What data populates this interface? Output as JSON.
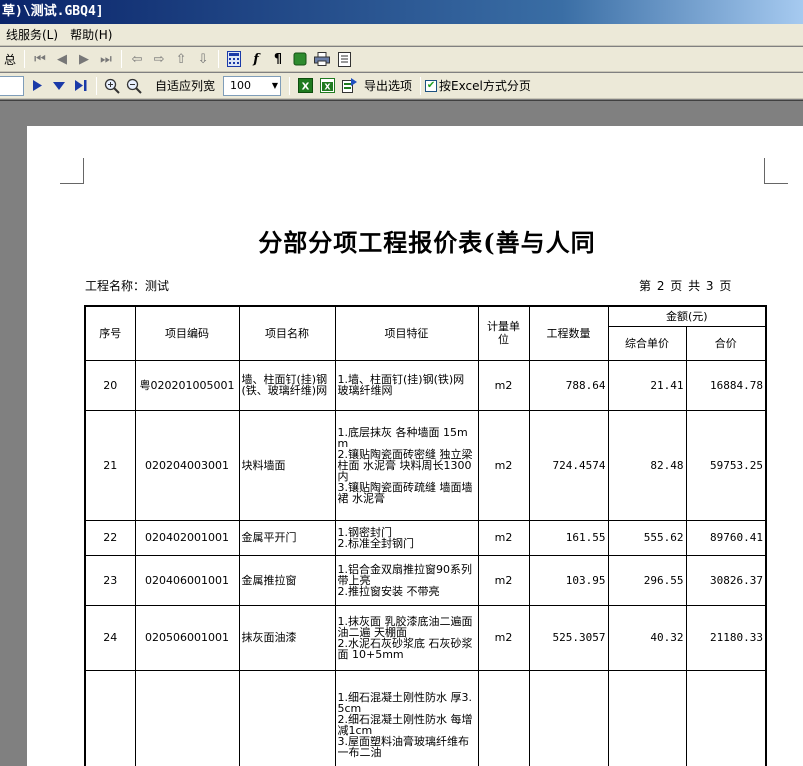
{
  "window": {
    "title": "草)\\测试.GBQ4]"
  },
  "menu": {
    "items": [
      "线服务(L)",
      "帮助(H)"
    ]
  },
  "toolbar1": {
    "left_label": "总"
  },
  "toolbar2": {
    "fit_width_label": "自适应列宽",
    "zoom_value": "100",
    "export_label": "导出选项",
    "excel_paging_label": "按Excel方式分页"
  },
  "report": {
    "title": "分部分项工程报价表(善与人同",
    "project_label": "工程名称：测试",
    "page_info": "第 2 页 共 3 页",
    "headers": {
      "seq": "序号",
      "code": "项目编码",
      "name": "项目名称",
      "feature": "项目特征",
      "unit": "计量单位",
      "qty": "工程数量",
      "amount": "金额(元)",
      "unit_price": "综合单价",
      "total": "合价"
    },
    "rows": [
      {
        "seq": "20",
        "code": "粤020201005001",
        "name": "墙、柱面钉(挂)钢(铁、玻璃纤维)网",
        "feature": "1.墙、柱面钉(挂)钢(铁)网 玻璃纤维网",
        "unit": "m2",
        "qty": "788.64",
        "unit_price": "21.41",
        "total": "16884.78"
      },
      {
        "seq": "21",
        "code": "020204003001",
        "name": "块料墙面",
        "feature": "1.底层抹灰 各种墙面 15mm\n2.镶贴陶瓷面砖密缝 独立梁柱面 水泥膏 块料周长1300内\n3.镶贴陶瓷面砖疏缝 墙面墙裙 水泥膏",
        "unit": "m2",
        "qty": "724.4574",
        "unit_price": "82.48",
        "total": "59753.25"
      },
      {
        "seq": "22",
        "code": "020402001001",
        "name": "金属平开门",
        "feature": "1.钢密封门\n2.标准全封钢门",
        "unit": "m2",
        "qty": "161.55",
        "unit_price": "555.62",
        "total": "89760.41"
      },
      {
        "seq": "23",
        "code": "020406001001",
        "name": "金属推拉窗",
        "feature": "1.铝合金双扇推拉窗90系列 带上亮\n2.推拉窗安装  不带亮",
        "unit": "m2",
        "qty": "103.95",
        "unit_price": "296.55",
        "total": "30826.37"
      },
      {
        "seq": "24",
        "code": "020506001001",
        "name": "抹灰面油漆",
        "feature": "1.抹灰面 乳胶漆底油二遍面油二遍 天棚面\n2.水泥石灰砂浆底 石灰砂浆面 10+5mm",
        "unit": "m2",
        "qty": "525.3057",
        "unit_price": "40.32",
        "total": "21180.33"
      },
      {
        "seq": "",
        "code": "",
        "name": "",
        "feature": "1.细石混凝土刚性防水 厚3.5cm\n2.细石混凝土刚性防水 每增减1cm\n3.屋面塑料油膏玻璃纤维布 一布二油",
        "unit": "",
        "qty": "",
        "unit_price": "",
        "total": ""
      }
    ]
  }
}
